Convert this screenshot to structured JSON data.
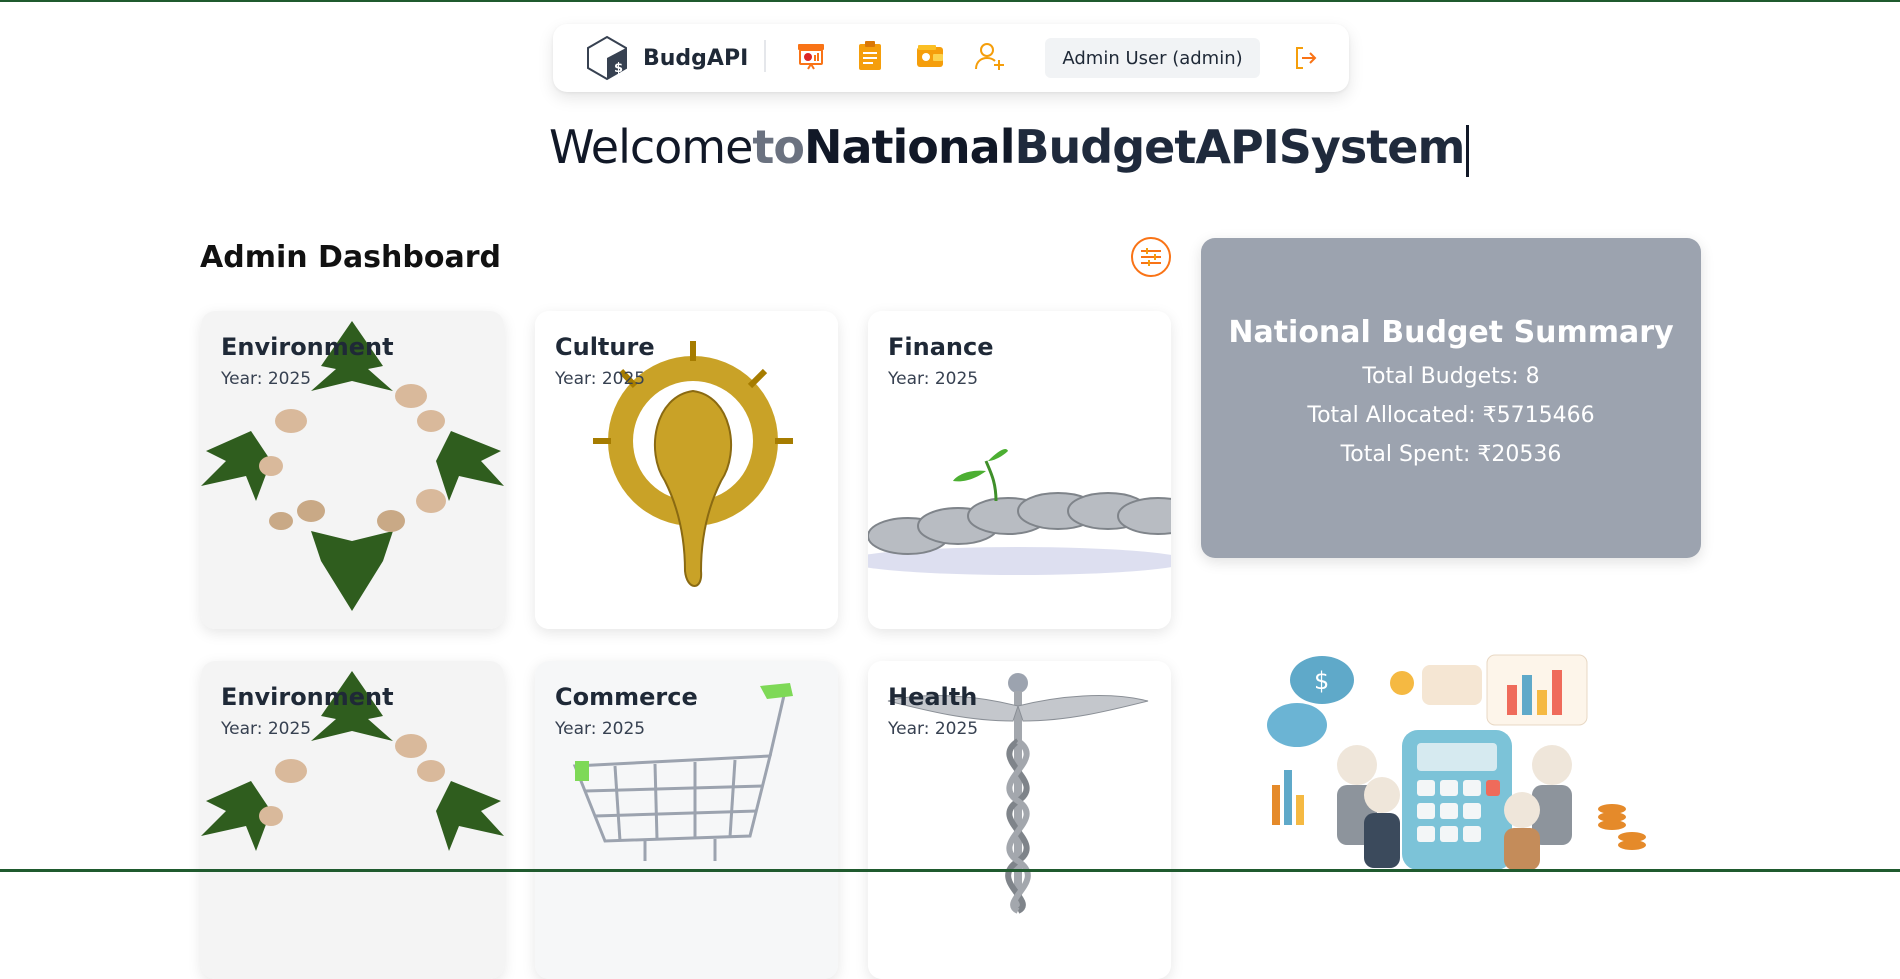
{
  "brand": {
    "name": "BudgAPI"
  },
  "nav": {
    "icons": [
      "budget-chart-icon",
      "clipboard-icon",
      "wallet-icon",
      "add-user-icon"
    ],
    "user_label": "Admin User (admin)",
    "accent": "#f97316"
  },
  "welcome": {
    "w1": "Welcome",
    "w2": "to",
    "w3": "National",
    "w4": "BudgetAPISystem"
  },
  "dashboard": {
    "title": "Admin Dashboard"
  },
  "cards": [
    {
      "title": "Environment",
      "year": "Year: 2025",
      "image": "ivy-leaves-and-stones"
    },
    {
      "title": "Culture",
      "year": "Year: 2025",
      "image": "brass-ganesha-sun"
    },
    {
      "title": "Finance",
      "year": "Year: 2025",
      "image": "coins-with-sprout"
    },
    {
      "title": "Environment",
      "year": "Year: 2025",
      "image": "ivy-leaves-and-stones"
    },
    {
      "title": "Commerce",
      "year": "Year: 2025",
      "image": "shopping-cart"
    },
    {
      "title": "Health",
      "year": "Year: 2025",
      "image": "caduceus"
    }
  ],
  "summary": {
    "title": "National Budget Summary",
    "total_budgets": "Total Budgets: 8",
    "total_allocated": "Total Allocated: ₹5715466",
    "total_spent": "Total Spent: ₹20536"
  }
}
